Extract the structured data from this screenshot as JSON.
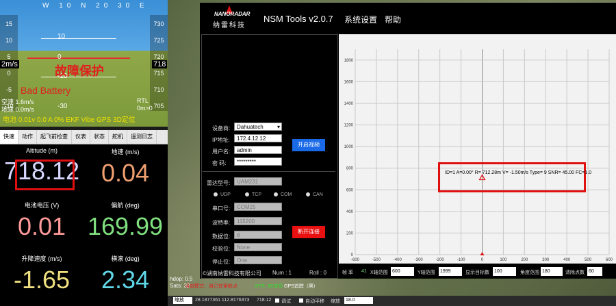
{
  "hud": {
    "fault_text": "故障保护",
    "bad_battery": "Bad Battery",
    "speed_left": "2m/s",
    "alt_right": "718",
    "left_tape": [
      "15",
      "10",
      "5",
      "0",
      "-5",
      "-10"
    ],
    "right_tape": [
      "730",
      "725",
      "720",
      "715",
      "710",
      "705"
    ],
    "ladder_labels": [
      "10",
      "0",
      "-10",
      "-20",
      "-30"
    ],
    "heading_labels": [
      "W",
      "10",
      "N",
      "20",
      "30",
      "E"
    ],
    "airspeed": "空速 1.6m/s",
    "groundspeed": "地速 0.0m/s",
    "rtl": "RTL",
    "rtl_dist": "0m>0",
    "bottom_line": "电池 0.01v 0.0 A 0%  EKF  Vibe  GPS 3D定位"
  },
  "quick_tabs": [
    "快速",
    "动作",
    "起飞前检查",
    "仪表",
    "状态",
    "舵机",
    "遥测日志"
  ],
  "quick": [
    {
      "label": "Altitude (m)",
      "value": "718.12",
      "color": "#d8d8ff"
    },
    {
      "label": "地速 (m/s)",
      "value": "0.04",
      "color": "#f0a070"
    },
    {
      "label": "电池电压 (V)",
      "value": "0.01",
      "color": "#ff9a9a"
    },
    {
      "label": "偏航 (deg)",
      "value": "169.99",
      "color": "#80e080"
    },
    {
      "label": "升降速度 (m/s)",
      "value": "-1.65",
      "color": "#f0e080"
    },
    {
      "label": "横滚 (deg)",
      "value": "2.34",
      "color": "#60d8e8"
    }
  ],
  "nsm": {
    "logo": "NANORADAR",
    "logo_cn": "纳雷科技",
    "title": "NSM Tools v2.0.7",
    "menu": [
      "系统设置",
      "帮助"
    ],
    "form": {
      "device_label": "设备商:",
      "device_value": "Dahuatech",
      "ip_label": "IP地址:",
      "ip_value": "172.4.12.12",
      "user_label": "用户名:",
      "user_value": "admin",
      "pwd_label": "密  码:",
      "pwd_value": "*********",
      "open_video": "开启视频",
      "radar_label": "雷达型号:",
      "radar_value": "UAM231",
      "radios": [
        "UDP",
        "TCP",
        "COM",
        "CAN"
      ],
      "port_label": "串口号:",
      "port_value": "COM25",
      "baud_label": "波特率:",
      "baud_value": "115200",
      "data_label": "数据位:",
      "data_value": "8",
      "check_label": "校验位:",
      "check_value": "None",
      "stop_label": "停止位:",
      "stop_value": "One",
      "disconnect": "断开连接",
      "company": "©湖南纳雷科技有限公司",
      "num": "Num : 1",
      "roll": "Roll : 0"
    },
    "target_text": "ID=1 A=0.00° R= 712.28m V= -1.50m/s Type= 9 SNR= 45.00 FC=1.0",
    "controls": {
      "frame_label": "帧 率",
      "frame_value": "41",
      "x_label": "X轴范围",
      "x_value": "600",
      "y_label": "Y轴范围",
      "y_value": "1999",
      "targets_label": "显示目标数",
      "targets_value": "100",
      "angle_label": "角度范围",
      "angle_value": "180",
      "clear_label": "清除点数",
      "clear_value": "60"
    }
  },
  "chart_data": {
    "type": "scatter",
    "x_ticks": [
      "-600",
      "-500",
      "-400",
      "-300",
      "-200",
      "-100",
      "0",
      "100",
      "200",
      "300",
      "400",
      "500",
      "600"
    ],
    "y_ticks": [
      "1800",
      "1600",
      "1400",
      "1200",
      "1000",
      "800",
      "600",
      "400",
      "200",
      "0"
    ],
    "xlim": [
      -600,
      600
    ],
    "ylim": [
      0,
      1900
    ],
    "grid": true,
    "points": [
      {
        "x": 0,
        "y": 712.28
      }
    ]
  },
  "map": {
    "hdop": "hdop: 0.5",
    "sats": "Sats: 32",
    "status_red": "当前模式：自己在第航点",
    "status_green": "GPS: 3D定位",
    "status_gps": "GPS追踪（黑）"
  },
  "bottom_bar": {
    "combo": "缩放",
    "coords": "28.1877361  112.8176373",
    "alt": "718.12",
    "debug": "调试",
    "auto_pan": "自动平移",
    "zoom_label": "缩放",
    "zoom_value": "18.0"
  }
}
